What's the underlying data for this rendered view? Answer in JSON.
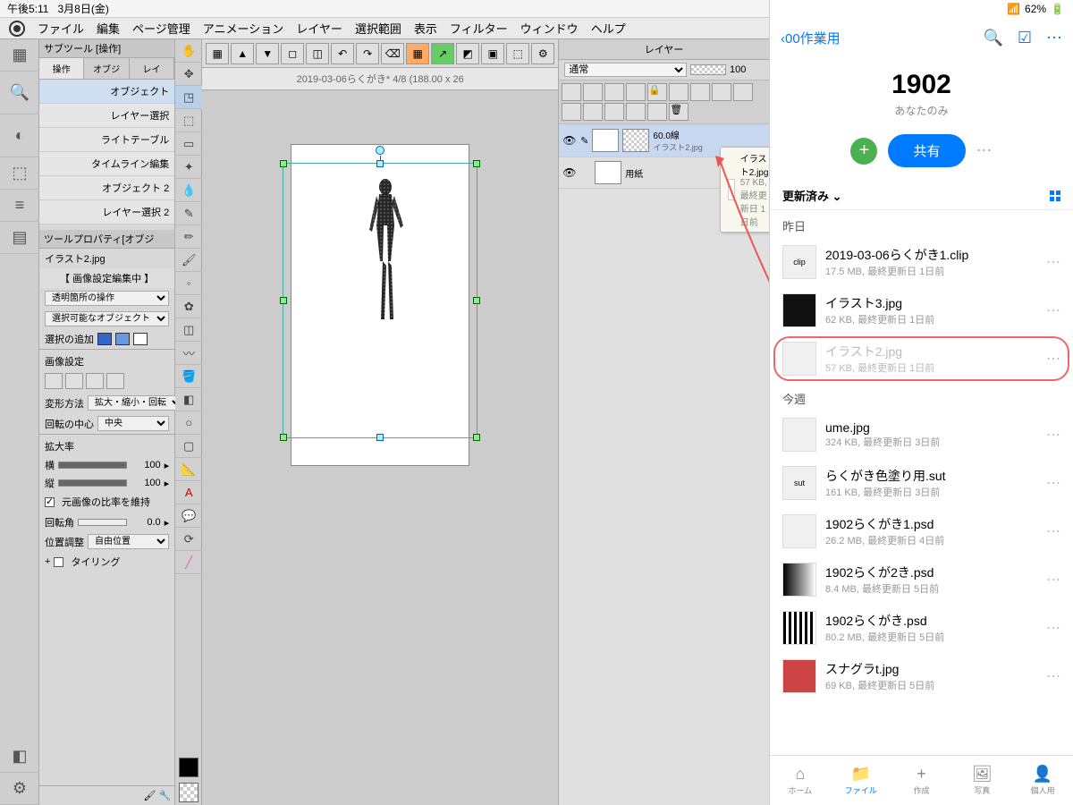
{
  "status": {
    "time": "午後5:11",
    "date": "3月8日(金)",
    "battery": "62%"
  },
  "menu": [
    "ファイル",
    "編集",
    "ページ管理",
    "アニメーション",
    "レイヤー",
    "選択範囲",
    "表示",
    "フィルター",
    "ウィンドウ",
    "ヘルプ"
  ],
  "subtool": {
    "title": "サブツール [操作]",
    "tabs": [
      "操作",
      "オブジ",
      "レイ"
    ],
    "items": [
      "オブジェクト",
      "レイヤー選択",
      "ライトテーブル",
      "タイムライン編集",
      "オブジェクト 2",
      "レイヤー選択 2"
    ]
  },
  "toolprop": {
    "title": "ツールプロパティ[オブジ",
    "file": "イラスト2.jpg",
    "editing": "【 画像設定編集中 】",
    "transp": "透明箇所の操作",
    "selectable": "選択可能なオブジェクト",
    "addsel": "選択の追加",
    "imgset": "画像設定",
    "transform_lbl": "変形方法",
    "transform_val": "拡大・縮小・回転",
    "center_lbl": "回転の中心",
    "center_val": "中央",
    "scale_lbl": "拡大率",
    "scale_w_lbl": "横",
    "scale_w": "100",
    "scale_h_lbl": "縦",
    "scale_h": "100",
    "keep_ratio": "元画像の比率を維持",
    "rot_lbl": "回転角",
    "rot_val": "0.0",
    "pos_lbl": "位置調整",
    "pos_val": "自由位置",
    "tiling": "タイリング"
  },
  "doc": {
    "tab": "2019-03-06らくがき* 4/8 (188.00 x 26"
  },
  "layers": {
    "title": "レイヤー",
    "mode": "通常",
    "opacity": "100",
    "items": [
      {
        "name": "60.0線",
        "sub": "イラスト2.jpg"
      },
      {
        "name": "用紙"
      }
    ]
  },
  "tooltip": {
    "name": "イラスト2.jpg",
    "meta": "57 KB, 最終更新日 1日前"
  },
  "dbx": {
    "back": "00作業用",
    "title": "1902",
    "sub": "あなたのみ",
    "share": "共有",
    "sort": "更新済み",
    "sec1": "昨日",
    "sec2": "今週",
    "files": [
      {
        "name": "2019-03-06らくがき1.clip",
        "meta": "17.5 MB, 最終更新日 1日前"
      },
      {
        "name": "イラスト3.jpg",
        "meta": "62 KB, 最終更新日 1日前"
      },
      {
        "name": "イラスト2.jpg",
        "meta": "57 KB, 最終更新日 1日前"
      },
      {
        "name": "ume.jpg",
        "meta": "324 KB, 最終更新日 3日前"
      },
      {
        "name": "らくがき色塗り用.sut",
        "meta": "161 KB, 最終更新日 3日前"
      },
      {
        "name": "1902らくがき1.psd",
        "meta": "26.2 MB, 最終更新日 4日前"
      },
      {
        "name": "1902らくが2き.psd",
        "meta": "8.4 MB, 最終更新日 5日前"
      },
      {
        "name": "1902らくがき.psd",
        "meta": "80.2 MB, 最終更新日 5日前"
      },
      {
        "name": "スナグラt.jpg",
        "meta": "69 KB, 最終更新日 5日前"
      }
    ],
    "tabs": [
      "ホーム",
      "ファイル",
      "作成",
      "写真",
      "個人用"
    ]
  }
}
